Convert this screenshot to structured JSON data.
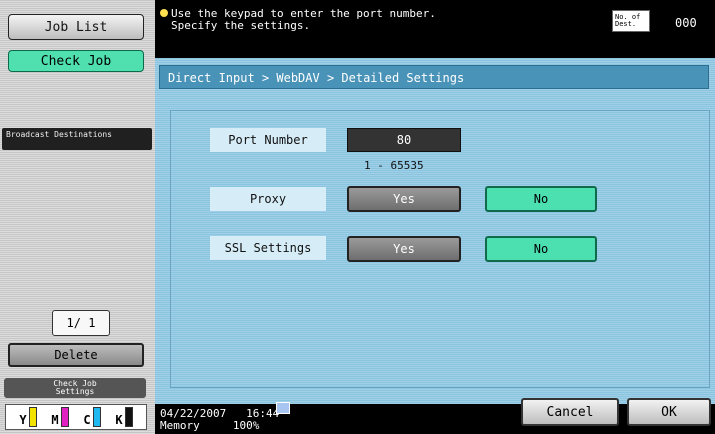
{
  "sidebar": {
    "job_list": "Job List",
    "check_job": "Check Job",
    "broadcast": "Broadcast Destinations",
    "page_indicator": "1/ 1",
    "delete": "Delete",
    "check_job_settings_line1": "Check Job",
    "check_job_settings_line2": "Settings",
    "toner": [
      {
        "label": "Y",
        "color": "#f2e400"
      },
      {
        "label": "M",
        "color": "#e020c0"
      },
      {
        "label": "C",
        "color": "#20b8f0"
      },
      {
        "label": "K",
        "color": "#111111"
      }
    ]
  },
  "header": {
    "message_line1": "Use the keypad to enter the port number.",
    "message_line2": "Specify the settings.",
    "dest_label": "No. of Dest.",
    "dest_count": "000"
  },
  "main": {
    "breadcrumb": "Direct Input > WebDAV > Detailed Settings",
    "port_label": "Port Number",
    "port_value": "80",
    "port_range": "1  -  65535",
    "proxy_label": "Proxy",
    "proxy_yes": "Yes",
    "proxy_no": "No",
    "ssl_label": "SSL Settings",
    "ssl_yes": "Yes",
    "ssl_no": "No"
  },
  "footer": {
    "date": "04/22/2007",
    "time": "16:44",
    "memory_label": "Memory",
    "memory_value": "100%",
    "cancel": "Cancel",
    "ok": "OK"
  }
}
